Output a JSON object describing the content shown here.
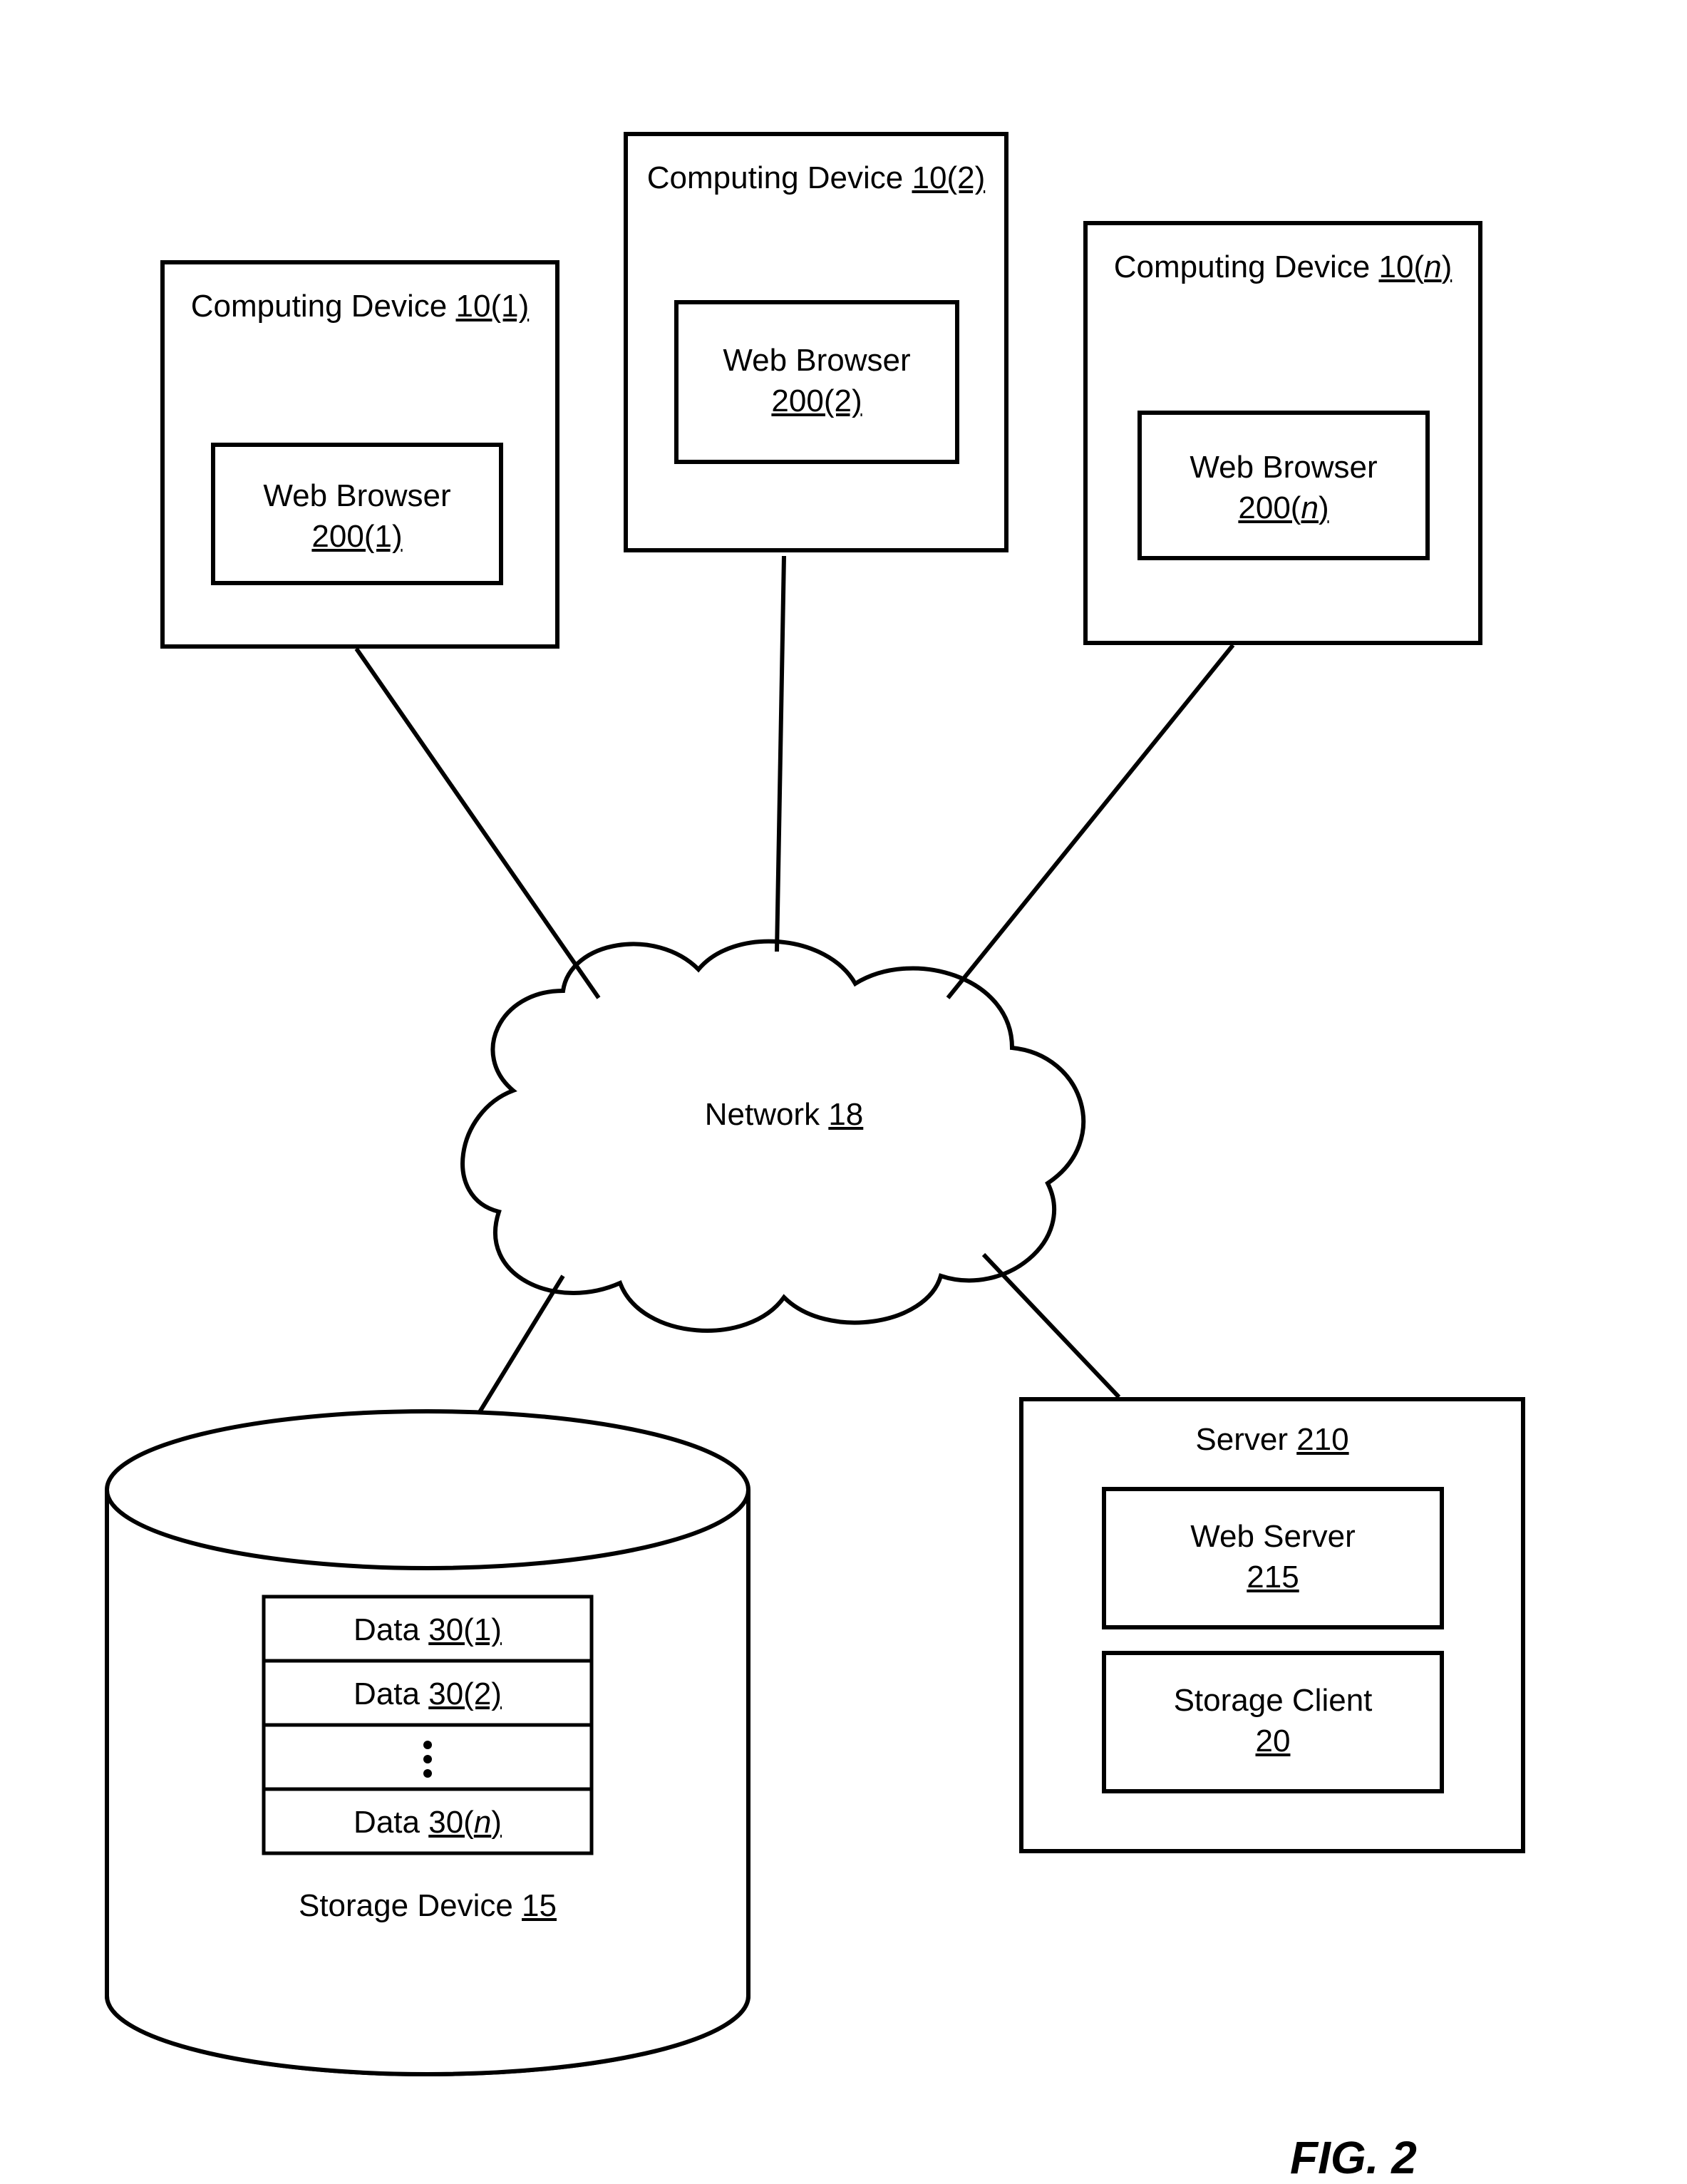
{
  "figureLabel": "FIG. 2",
  "devices": [
    {
      "title_prefix": "Computing Device ",
      "title_ref": "10(1)",
      "inner_label1": "Web Browser",
      "inner_ref": "200(1)"
    },
    {
      "title_prefix": "Computing Device ",
      "title_ref": "10(2)",
      "inner_label1": "Web Browser",
      "inner_ref": "200(2)"
    },
    {
      "title_prefix": "Computing Device ",
      "title_ref_pre": "10(",
      "title_ref_ital": "n",
      "title_ref_post": ")",
      "inner_label1": "Web Browser",
      "inner_ref_pre": "200(",
      "inner_ref_ital": "n",
      "inner_ref_post": ")"
    }
  ],
  "network": {
    "label_prefix": "Network ",
    "ref": "18"
  },
  "server": {
    "title_prefix": "Server ",
    "title_ref": "210",
    "webserver_label": "Web Server",
    "webserver_ref": "215",
    "storageclient_label": "Storage Client",
    "storageclient_ref": "20"
  },
  "storage": {
    "title_prefix": "Storage Device ",
    "title_ref": "15",
    "data": [
      {
        "prefix": "Data ",
        "ref": "30(1)"
      },
      {
        "prefix": "Data ",
        "ref": "30(2)"
      },
      {
        "prefix": "Data ",
        "ref_pre": "30(",
        "ref_ital": "n",
        "ref_post": ")"
      }
    ]
  }
}
